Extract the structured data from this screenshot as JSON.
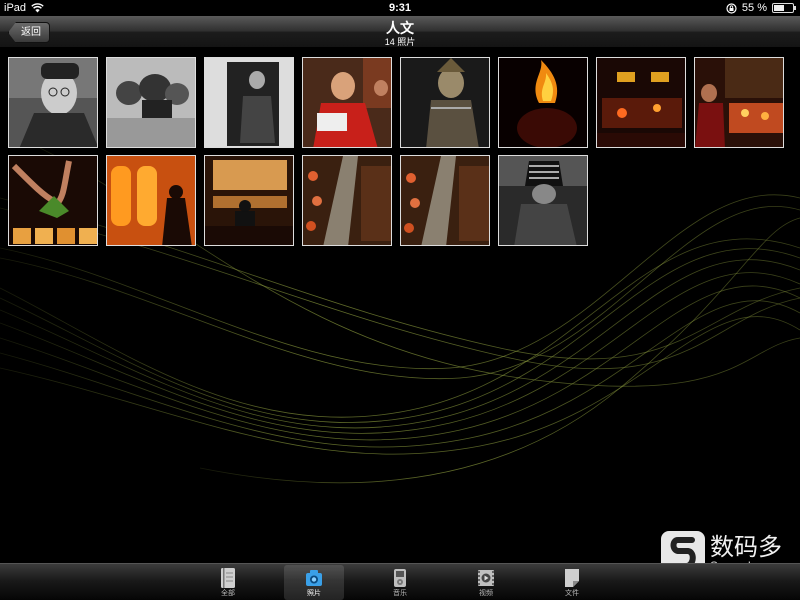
{
  "status_bar": {
    "device": "iPad",
    "time": "9:31",
    "battery_text": "55 %",
    "battery_level": 0.55
  },
  "nav": {
    "back_label": "返回",
    "title": "人文",
    "subtitle": "14 照片"
  },
  "tabs": [
    {
      "label": "全部",
      "icon": "notebook-icon",
      "active": false
    },
    {
      "label": "照片",
      "icon": "camera-icon",
      "active": true
    },
    {
      "label": "音乐",
      "icon": "music-player-icon",
      "active": false
    },
    {
      "label": "视频",
      "icon": "video-icon",
      "active": false
    },
    {
      "label": "文件",
      "icon": "document-icon",
      "active": false
    }
  ],
  "photos": [
    {
      "subject": "elderly-man-portrait",
      "tone": "bw"
    },
    {
      "subject": "baskets-on-street",
      "tone": "bw"
    },
    {
      "subject": "man-in-doorway",
      "tone": "bw"
    },
    {
      "subject": "monk-in-red-robe",
      "tone": "color"
    },
    {
      "subject": "masked-dancer",
      "tone": "color"
    },
    {
      "subject": "fire-in-dark",
      "tone": "color"
    },
    {
      "subject": "lit-shop-at-night",
      "tone": "color"
    },
    {
      "subject": "market-stall-night",
      "tone": "color"
    },
    {
      "subject": "hands-with-candles",
      "tone": "color"
    },
    {
      "subject": "silhouettes-amber-lanterns",
      "tone": "color"
    },
    {
      "subject": "shop-interior",
      "tone": "color"
    },
    {
      "subject": "night-market-street",
      "tone": "color"
    },
    {
      "subject": "night-market-street-2",
      "tone": "color"
    },
    {
      "subject": "person-in-headwrap",
      "tone": "bw"
    }
  ],
  "watermark": {
    "brand_cn": "数码多",
    "brand_en": "Soomal.com"
  },
  "colors": {
    "wave": "#8a9a3c",
    "nav_top": "#5a5a5a",
    "nav_bottom": "#141414",
    "thumb_border": "#dddddd"
  }
}
